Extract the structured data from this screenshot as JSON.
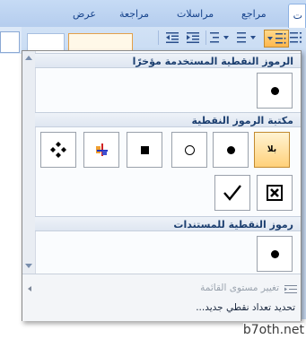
{
  "ribbon": {
    "tabs": [
      "عرض",
      "مراجعة",
      "مراسلات",
      "مراجع",
      "ت"
    ]
  },
  "gallery": {
    "recent_section_title": "الرموز النقطية المستخدمة مؤخرًا",
    "library_section_title": "مكتبة الرموز النقطية",
    "document_section_title": "رموز النقطية للمستندات",
    "none_label": "بلا",
    "icons": {
      "recent": [
        "black-circle-bullet"
      ],
      "library_row1": [
        "none",
        "black-circle-bullet",
        "white-circle-bullet",
        "black-square-bullet",
        "arrow-cross-bullet",
        "diamond-four-bullet"
      ],
      "library_row2": [
        "box-x-bullet",
        "check-mark-bullet"
      ],
      "document": [
        "black-circle-bullet"
      ]
    }
  },
  "menu": {
    "change_list_level": "تغيير مستوى القائمة",
    "define_new_bullet": "تحديد تعداد نقطي جديد..."
  },
  "symbols": {
    "check": "✓",
    "box_x": "☒"
  },
  "watermark": "b7oth.net",
  "colors": {
    "selected_bg": "#ffd17a",
    "header_text": "#1b3e6f",
    "ribbon": "#c9dcf3"
  }
}
